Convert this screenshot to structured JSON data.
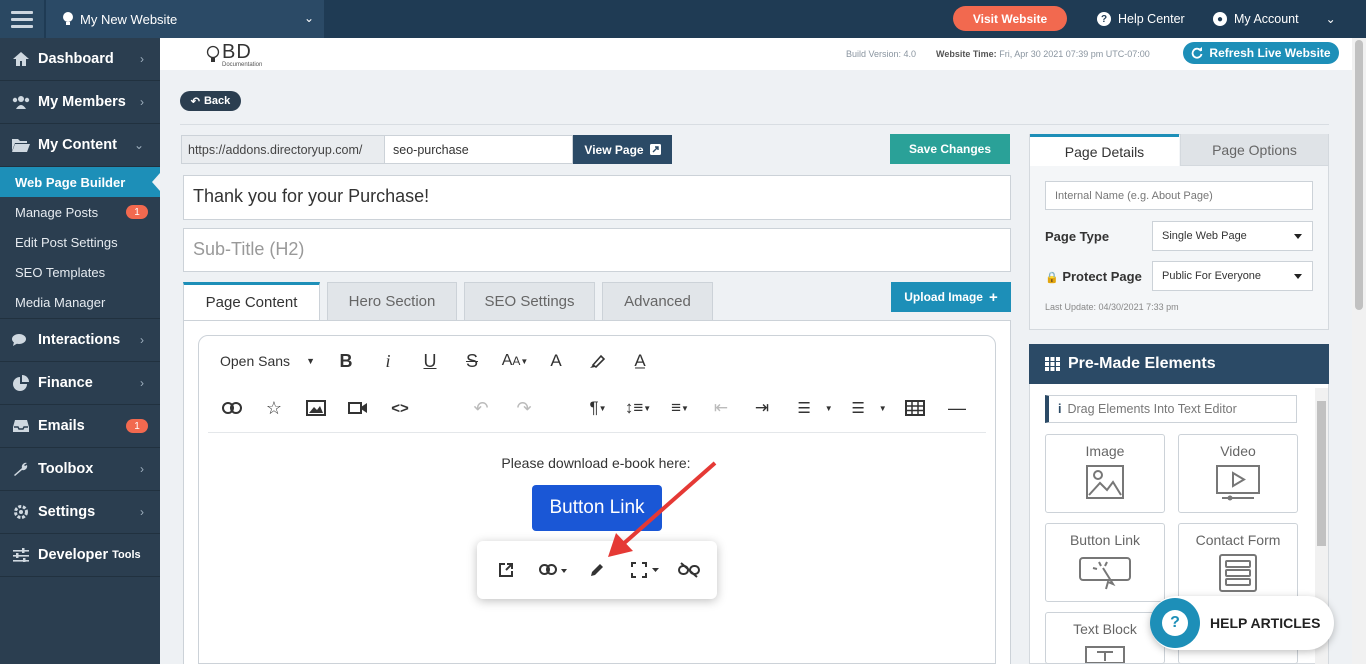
{
  "topbar": {
    "site_name": "My New Website",
    "visit_button": "Visit Website",
    "help_center": "Help Center",
    "my_account": "My Account"
  },
  "sidebar": {
    "items": [
      {
        "label": "Dashboard",
        "icon": "home-icon"
      },
      {
        "label": "My Members",
        "icon": "users-icon"
      },
      {
        "label": "My Content",
        "icon": "folder-open-icon"
      }
    ],
    "sub_items": [
      {
        "label": "Web Page Builder",
        "active": true
      },
      {
        "label": "Manage Posts",
        "badge": "1"
      },
      {
        "label": "Edit Post Settings"
      },
      {
        "label": "SEO Templates"
      },
      {
        "label": "Media Manager"
      }
    ],
    "items_after": [
      {
        "label": "Interactions",
        "icon": "chat-icon"
      },
      {
        "label": "Finance",
        "icon": "pie-chart-icon"
      },
      {
        "label": "Emails",
        "icon": "inbox-icon",
        "badge": "1"
      },
      {
        "label": "Toolbox",
        "icon": "wrench-icon"
      },
      {
        "label": "Settings",
        "icon": "gear-icon"
      },
      {
        "label": "Developer",
        "suffix": "Tools",
        "icon": "sliders-icon"
      }
    ]
  },
  "header": {
    "logo_text": "BD",
    "logo_sub": "Documentation",
    "build_version": "Build Version: 4.0",
    "website_time_label": "Website Time:",
    "website_time_value": "Fri, Apr 30 2021 07:39 pm UTC-07:00",
    "refresh_button": "Refresh Live Website",
    "back_button": "Back"
  },
  "editor": {
    "url_prefix": "https://addons.directoryup.com/",
    "url_slug": "seo-purchase",
    "view_page_button": "View Page",
    "save_button": "Save Changes",
    "title_value": "Thank you for your Purchase!",
    "subtitle_placeholder": "Sub-Title (H2)",
    "tabs": [
      "Page Content",
      "Hero Section",
      "SEO Settings",
      "Advanced"
    ],
    "upload_button": "Upload Image",
    "font_family": "Open Sans",
    "body_text": "Please download e-book here:",
    "button_link_text": "Button Link"
  },
  "right_panel": {
    "tabs": [
      "Page Details",
      "Page Options"
    ],
    "internal_name_placeholder": "Internal Name (e.g. About Page)",
    "page_type_label": "Page Type",
    "page_type_value": "Single Web Page",
    "protect_label": "Protect Page",
    "protect_value": "Public For Everyone",
    "last_update": "Last Update: 04/30/2021 7:33 pm",
    "premade_title": "Pre-Made Elements",
    "drag_hint": "Drag Elements Into Text Editor",
    "elements": [
      "Image",
      "Video",
      "Button Link",
      "Contact Form",
      "Text Block"
    ]
  },
  "help": {
    "label": "HELP ARTICLES"
  },
  "colors": {
    "topbar": "#1f3b54",
    "sidebar": "#2b3e50",
    "accent_blue": "#1d8fb8",
    "orange": "#f2694f",
    "teal": "#2aa198",
    "button_link": "#1a57d6",
    "arrow": "#e53935"
  }
}
